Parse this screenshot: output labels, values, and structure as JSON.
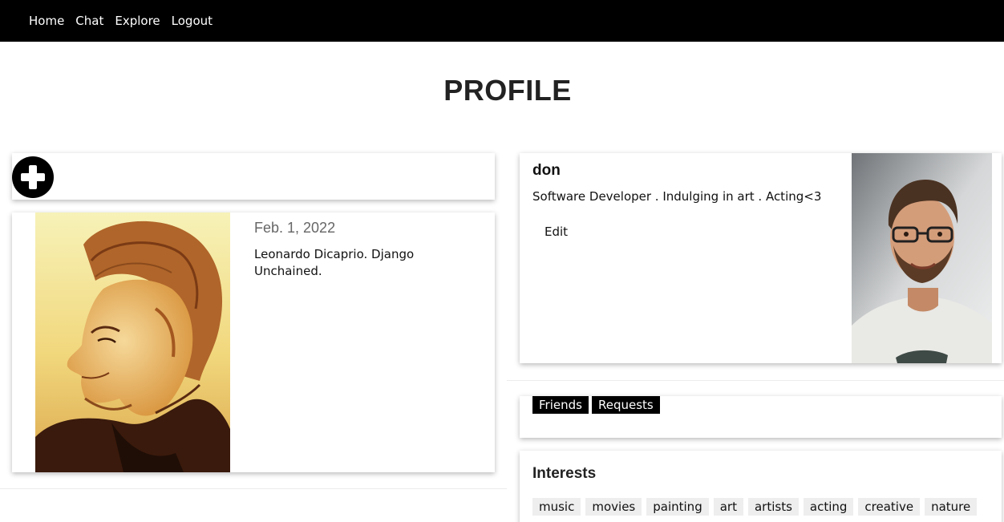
{
  "nav": {
    "items": [
      "Home",
      "Chat",
      "Explore",
      "Logout"
    ]
  },
  "page": {
    "title": "PROFILE"
  },
  "add_post": {
    "icon": "plus-circle-icon"
  },
  "post": {
    "date": "Feb. 1, 2022",
    "caption": "Leonardo Dicaprio. Django Unchained."
  },
  "profile": {
    "username": "don",
    "bio": "Software Developer . Indulging in art . Acting<3",
    "edit_label": "Edit"
  },
  "social": {
    "friends_label": "Friends",
    "requests_label": "Requests"
  },
  "interests": {
    "title": "Interests",
    "items": [
      "music",
      "movies",
      "painting",
      "art",
      "artists",
      "acting",
      "creative",
      "nature"
    ]
  },
  "colors": {
    "navbar_bg": "#000000",
    "tag_bg": "#000000",
    "interest_bg": "#eeeeee"
  }
}
